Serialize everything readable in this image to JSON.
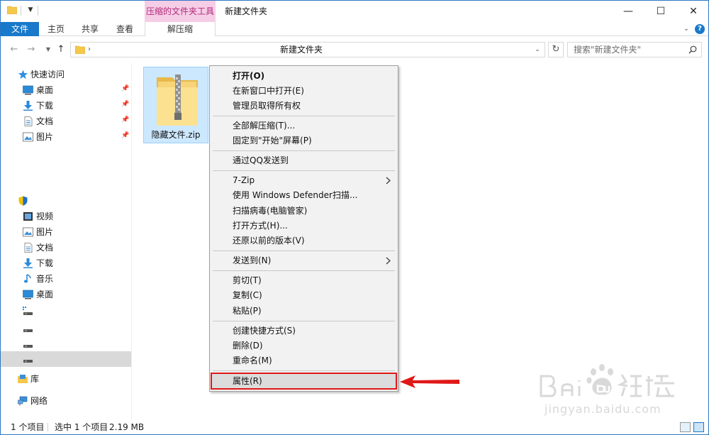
{
  "titlebar": {
    "context_tool_tab": "压缩的文件夹工具",
    "window_title": "新建文件夹",
    "minimize_glyph": "—",
    "maximize_glyph": "☐",
    "close_glyph": "✕"
  },
  "ribbon": {
    "tabs": [
      "文件",
      "主页",
      "共享",
      "查看"
    ],
    "context_tab": "解压缩",
    "help_glyph": "?"
  },
  "address": {
    "path": "新建文件夹",
    "search_placeholder": "搜索\"新建文件夹\""
  },
  "sidebar": {
    "quick_access": "快速访问",
    "quick_items": [
      "桌面",
      "下载",
      "文档",
      "图片"
    ],
    "pc_items": [
      "视频",
      "图片",
      "文档",
      "下载",
      "音乐",
      "桌面"
    ],
    "library": "库",
    "network": "网络"
  },
  "content": {
    "file_name": "隐藏文件.zip"
  },
  "context_menu": {
    "group1": [
      "打开(O)",
      "在新窗口中打开(E)",
      "管理员取得所有权"
    ],
    "group2": [
      "全部解压缩(T)...",
      "固定到\"开始\"屏幕(P)"
    ],
    "group3": [
      "通过QQ发送到"
    ],
    "group4": [
      "7-Zip",
      "使用 Windows Defender扫描...",
      "扫描病毒(电脑管家)",
      "打开方式(H)...",
      "还原以前的版本(V)"
    ],
    "group5": [
      "发送到(N)"
    ],
    "group6": [
      "剪切(T)",
      "复制(C)",
      "粘贴(P)"
    ],
    "group7": [
      "创建快捷方式(S)",
      "删除(D)",
      "重命名(M)"
    ],
    "group8": [
      "属性(R)"
    ]
  },
  "statusbar": {
    "item_count": "1 个项目",
    "selected": "选中 1 个项目",
    "size": "2.19 MB"
  },
  "watermark": {
    "url": "jingyan.baidu.com"
  },
  "colors": {
    "accent": "#1979ca",
    "context_tab_bg": "#f6cde6",
    "highlight_border": "#e01818"
  }
}
